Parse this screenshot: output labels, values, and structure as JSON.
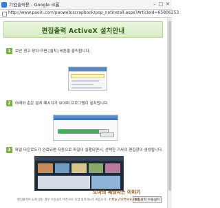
{
  "window": {
    "title": "기업출력용 - Google 크롬",
    "controls": [
      "–",
      "□",
      "✕"
    ],
    "url": "http://www.paoin.com/paoweb/scrapbook/pop_notinstall.aspx?ArticleId=65806253"
  },
  "page": {
    "title": "편집출력 ActiveX 설치안내",
    "steps": [
      {
        "num": "1",
        "text": "보안 경고 창이 뜨면 [설치] 버튼을 클릭합니다."
      },
      {
        "num": "2",
        "text": "아래와 같은 설치 메시지가 보이며 프로그램이 설치됩니다."
      },
      {
        "num": "3",
        "text": "파일 다운로드가 완료되면 자동으로 파일이 실행되면서, 선택한 기사의 편집창이 생성됩니다."
      }
    ],
    "progress_fraction": 0.82,
    "footer_note": "편집출력이 되지 않는 경우 수동설치 버튼으로 직접 설치하시기 바랍니다.",
    "manual_install_button": "편집출력 수동설치"
  },
  "watermark": {
    "blog": "도아의 세상사는 이야기",
    "url": "http://offree.net"
  },
  "colors": {
    "accent_green": "#7bb241",
    "header_text": "#2f5d17",
    "progress_green": "#39b54a"
  }
}
